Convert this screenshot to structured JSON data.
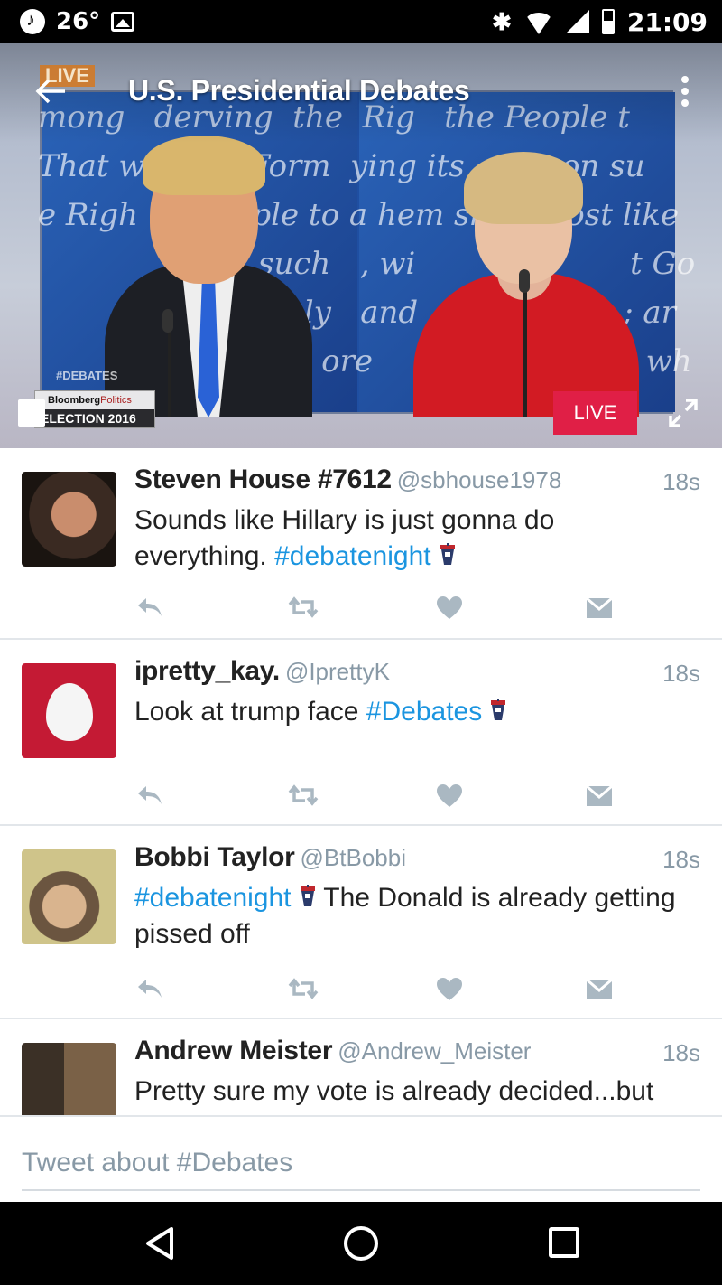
{
  "status_bar": {
    "temperature": "26°",
    "time": "21:09"
  },
  "video": {
    "live_tag": "LIVE",
    "title": "U.S. Presidential Debates",
    "hashtag_overlay": "#DEBATES",
    "bloomberg_brand": "Bloomberg",
    "bloomberg_sub": "Politics",
    "election_label": "ELECTION 2016",
    "live_button": "LIVE"
  },
  "tweets": [
    {
      "name": "Steven House #7612",
      "handle": "@sbhouse1978",
      "time": "18s",
      "text_before": "Sounds like Hillary is just gonna do everything. ",
      "hashtag": "#debatenight",
      "text_after": ""
    },
    {
      "name": "ipretty_kay.",
      "handle": "@IprettyK",
      "time": "18s",
      "text_before": "Look at trump face ",
      "hashtag": "#Debates",
      "text_after": ""
    },
    {
      "name": "Bobbi Taylor",
      "handle": "@BtBobbi",
      "time": "18s",
      "text_before": "",
      "hashtag": "#debatenight",
      "text_after": " The Donald is already getting pissed off"
    },
    {
      "name": "Andrew Meister",
      "handle": "@Andrew_Meister",
      "time": "18s",
      "text_before": "Pretty sure my vote is already decided...but",
      "hashtag": "",
      "text_after": ""
    }
  ],
  "compose": {
    "placeholder": "Tweet about #Debates"
  },
  "colors": {
    "accent": "#1b95e0",
    "live_red": "#e01f46",
    "meta_gray": "#8899a6"
  },
  "icons": [
    "back-arrow-icon",
    "more-vert-icon",
    "expand-icon",
    "reply-icon",
    "retweet-icon",
    "like-icon",
    "dm-icon",
    "podium-emoji-icon"
  ]
}
